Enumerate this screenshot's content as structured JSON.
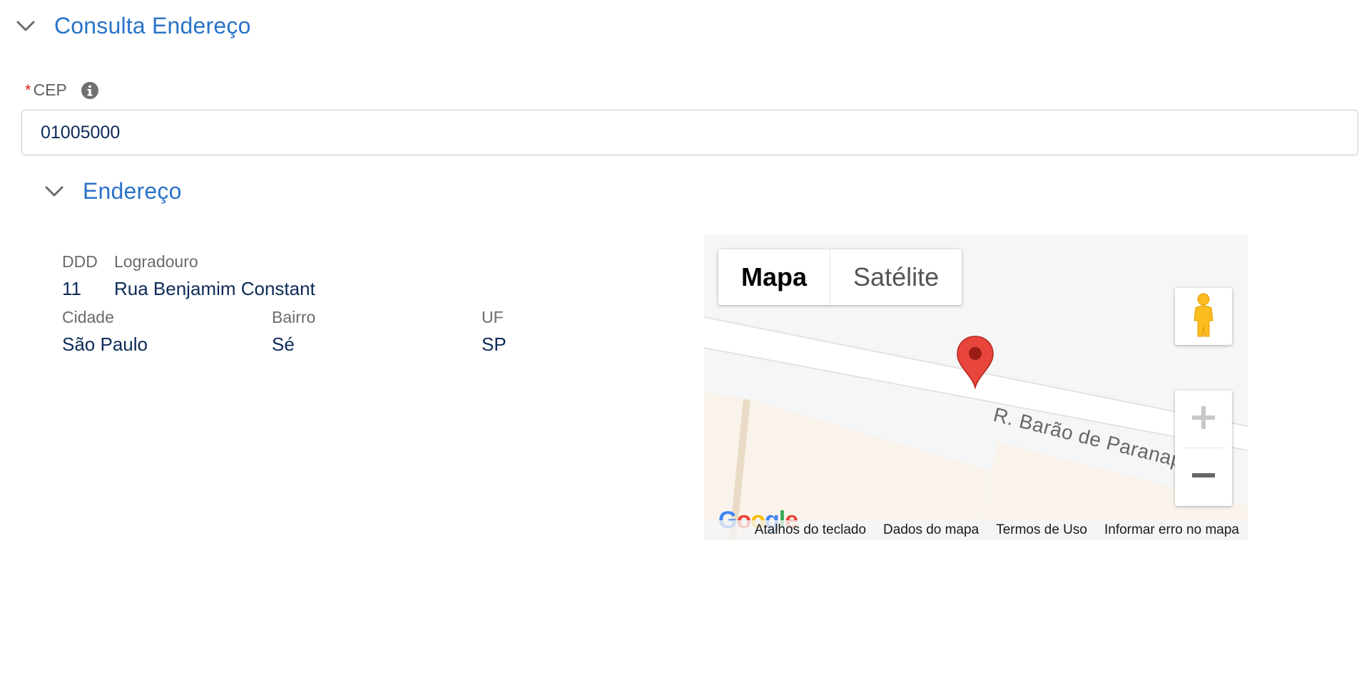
{
  "sections": {
    "main_title": "Consulta Endereço",
    "sub_title": "Endereço"
  },
  "cep": {
    "required_marker": "*",
    "label": "CEP",
    "value": "01005000"
  },
  "address": {
    "ddd_label": "DDD",
    "ddd_value": "11",
    "logradouro_label": "Logradouro",
    "logradouro_value": "Rua Benjamim Constant",
    "cidade_label": "Cidade",
    "cidade_value": "São Paulo",
    "bairro_label": "Bairro",
    "bairro_value": "Sé",
    "uf_label": "UF",
    "uf_value": "SP"
  },
  "map": {
    "type_map": "Mapa",
    "type_satellite": "Satélite",
    "street_name": "R. Barão de Paranapi",
    "logo": "Google",
    "footer": {
      "shortcuts": "Atalhos do teclado",
      "data": "Dados do mapa",
      "terms": "Termos de Uso",
      "report": "Informar erro no mapa"
    },
    "zoom_in_symbol": "+",
    "zoom_out_symbol": "−"
  },
  "colors": {
    "accent": "#2a73c9",
    "value_text": "#0d2a57",
    "required": "#d42222"
  },
  "icons": [
    "chevron-down-icon",
    "info-icon",
    "pegman-icon",
    "map-pin-icon",
    "zoom-in-icon",
    "zoom-out-icon"
  ]
}
